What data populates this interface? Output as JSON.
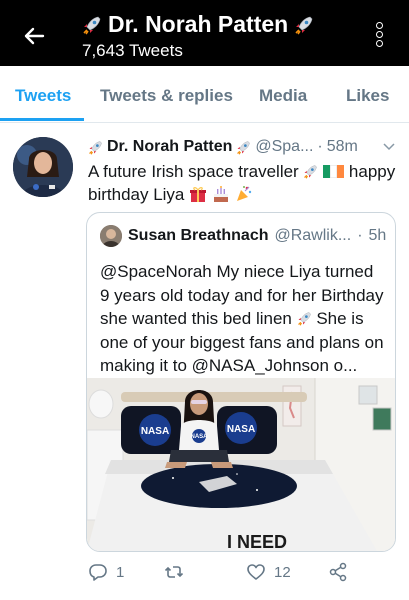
{
  "header": {
    "title": "Dr. Norah Patten",
    "tweet_count": "7,643 Tweets"
  },
  "tabs": [
    {
      "label": "Tweets",
      "active": true
    },
    {
      "label": "Tweets & replies",
      "active": false
    },
    {
      "label": "Media",
      "active": false
    },
    {
      "label": "Likes",
      "active": false
    }
  ],
  "tweet": {
    "author_name": "Dr. Norah Patten",
    "handle": "@Spa...",
    "separator": "·",
    "time": "58m",
    "text_part1": "A future Irish space traveller",
    "text_part2": "happy birthday Liya",
    "quoted": {
      "author_name": "Susan Breathnach",
      "handle": "@Rawlik...",
      "separator": "·",
      "time": "5h",
      "text_part1": "@SpaceNorah My niece Liya turned 9 years old today and for her Birthday she wanted this bed linen",
      "text_part2": "She is one of your biggest fans and plans on making it to @NASA_Johnson o...",
      "image_text": {
        "pillow": "NASA",
        "shirt": "NASA",
        "duvet": "I NEED"
      }
    },
    "actions": {
      "replies": "1",
      "retweets": "",
      "likes": "12"
    }
  },
  "colors": {
    "accent": "#1da1f2",
    "header_bg": "#000000",
    "muted": "#657786"
  },
  "icons": [
    "back-arrow-icon",
    "more-vertical-icon",
    "rocket-icon",
    "chevron-down-icon",
    "reply-icon",
    "retweet-icon",
    "like-icon",
    "share-icon"
  ]
}
